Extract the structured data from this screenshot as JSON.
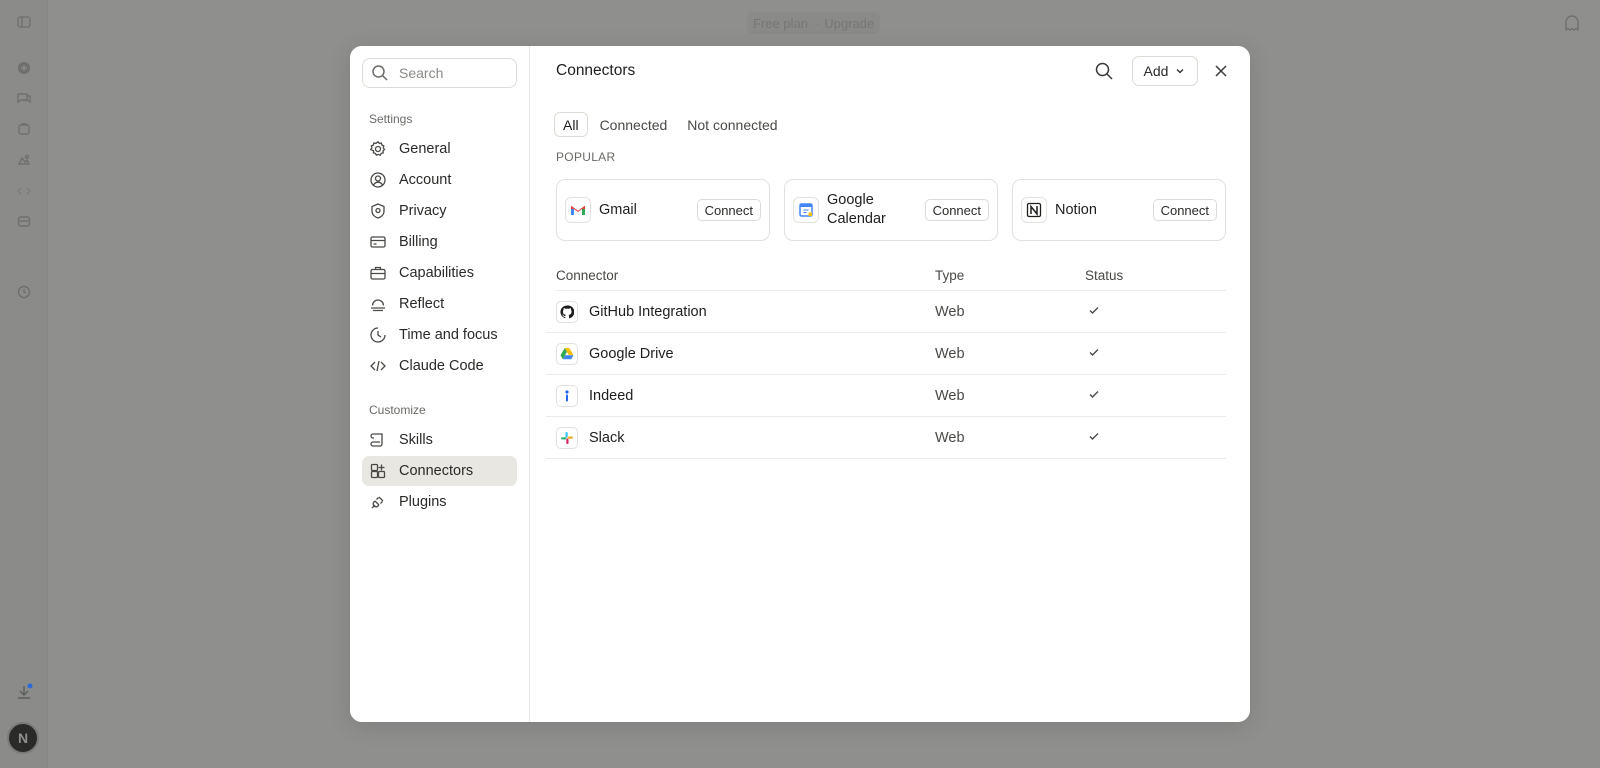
{
  "background": {
    "plan_label": "Free plan",
    "upgrade_label": "Upgrade",
    "avatar_initial": "N"
  },
  "sidebar": {
    "search_placeholder": "Search",
    "settings_label": "Settings",
    "settings_items": [
      {
        "label": "General",
        "icon": "gear-icon"
      },
      {
        "label": "Account",
        "icon": "user-circle-icon"
      },
      {
        "label": "Privacy",
        "icon": "shield-icon"
      },
      {
        "label": "Billing",
        "icon": "credit-card-icon"
      },
      {
        "label": "Capabilities",
        "icon": "briefcase-icon"
      },
      {
        "label": "Reflect",
        "icon": "sunrise-icon"
      },
      {
        "label": "Time and focus",
        "icon": "moon-clock-icon"
      },
      {
        "label": "Claude Code",
        "icon": "code-icon"
      }
    ],
    "customize_label": "Customize",
    "customize_items": [
      {
        "label": "Skills",
        "icon": "scroll-icon"
      },
      {
        "label": "Connectors",
        "icon": "grid-plus-icon",
        "active": true
      },
      {
        "label": "Plugins",
        "icon": "plug-icon"
      }
    ]
  },
  "main": {
    "title": "Connectors",
    "add_label": "Add",
    "tabs": [
      "All",
      "Connected",
      "Not connected"
    ],
    "active_tab": "All",
    "popular_label": "POPULAR",
    "popular": [
      {
        "name": "Gmail",
        "action": "Connect",
        "icon": "gmail-icon"
      },
      {
        "name": "Google Calendar",
        "action": "Connect",
        "icon": "google-calendar-icon"
      },
      {
        "name": "Notion",
        "action": "Connect",
        "icon": "notion-icon"
      }
    ],
    "table": {
      "headers": {
        "connector": "Connector",
        "type": "Type",
        "status": "Status"
      },
      "rows": [
        {
          "name": "GitHub Integration",
          "type": "Web",
          "icon": "github-icon",
          "connected": true
        },
        {
          "name": "Google Drive",
          "type": "Web",
          "icon": "google-drive-icon",
          "connected": true
        },
        {
          "name": "Indeed",
          "type": "Web",
          "icon": "indeed-icon",
          "connected": true
        },
        {
          "name": "Slack",
          "type": "Web",
          "icon": "slack-icon",
          "connected": true
        }
      ]
    }
  }
}
